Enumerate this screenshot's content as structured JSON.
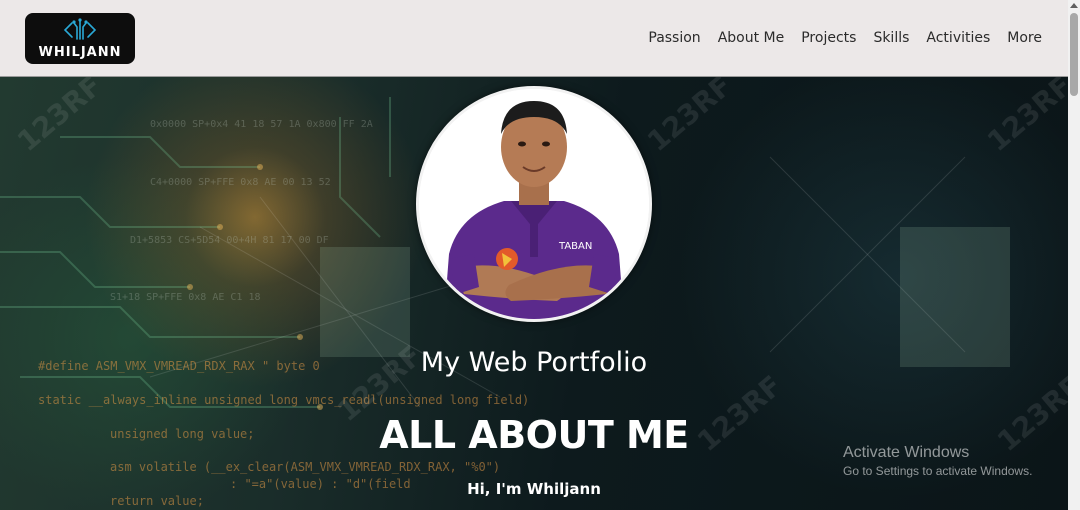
{
  "nav": {
    "logo_text": "WHILJANN",
    "links": [
      "Passion",
      "About Me",
      "Projects",
      "Skills",
      "Activities",
      "More"
    ]
  },
  "hero": {
    "subtitle": "My Web Portfolio",
    "heading": "ALL ABOUT ME",
    "greeting": "Hi, I'm Whiljann"
  },
  "background_code": [
    "#define ASM_VMX_VMREAD_RDX_RAX   \" byte 0",
    "static __always_inline unsigned long vmcs_readl(unsigned long field)",
    "    unsigned long value;",
    "    asm volatile (__ex_clear(ASM_VMX_VMREAD_RDX_RAX, \"%0\")",
    "          : \"=a\"(value) : \"d\"(field",
    "    return value;"
  ],
  "watermark_text": "123RF",
  "os_overlay": {
    "title": "Activate Windows",
    "subtitle": "Go to Settings to activate Windows."
  },
  "colors": {
    "navbar_bg": "#ece8e8",
    "logo_bg": "#0d0d0d",
    "logo_accent": "#2aa9d6",
    "shirt": "#5b2a8c",
    "text_white": "#ffffff"
  }
}
